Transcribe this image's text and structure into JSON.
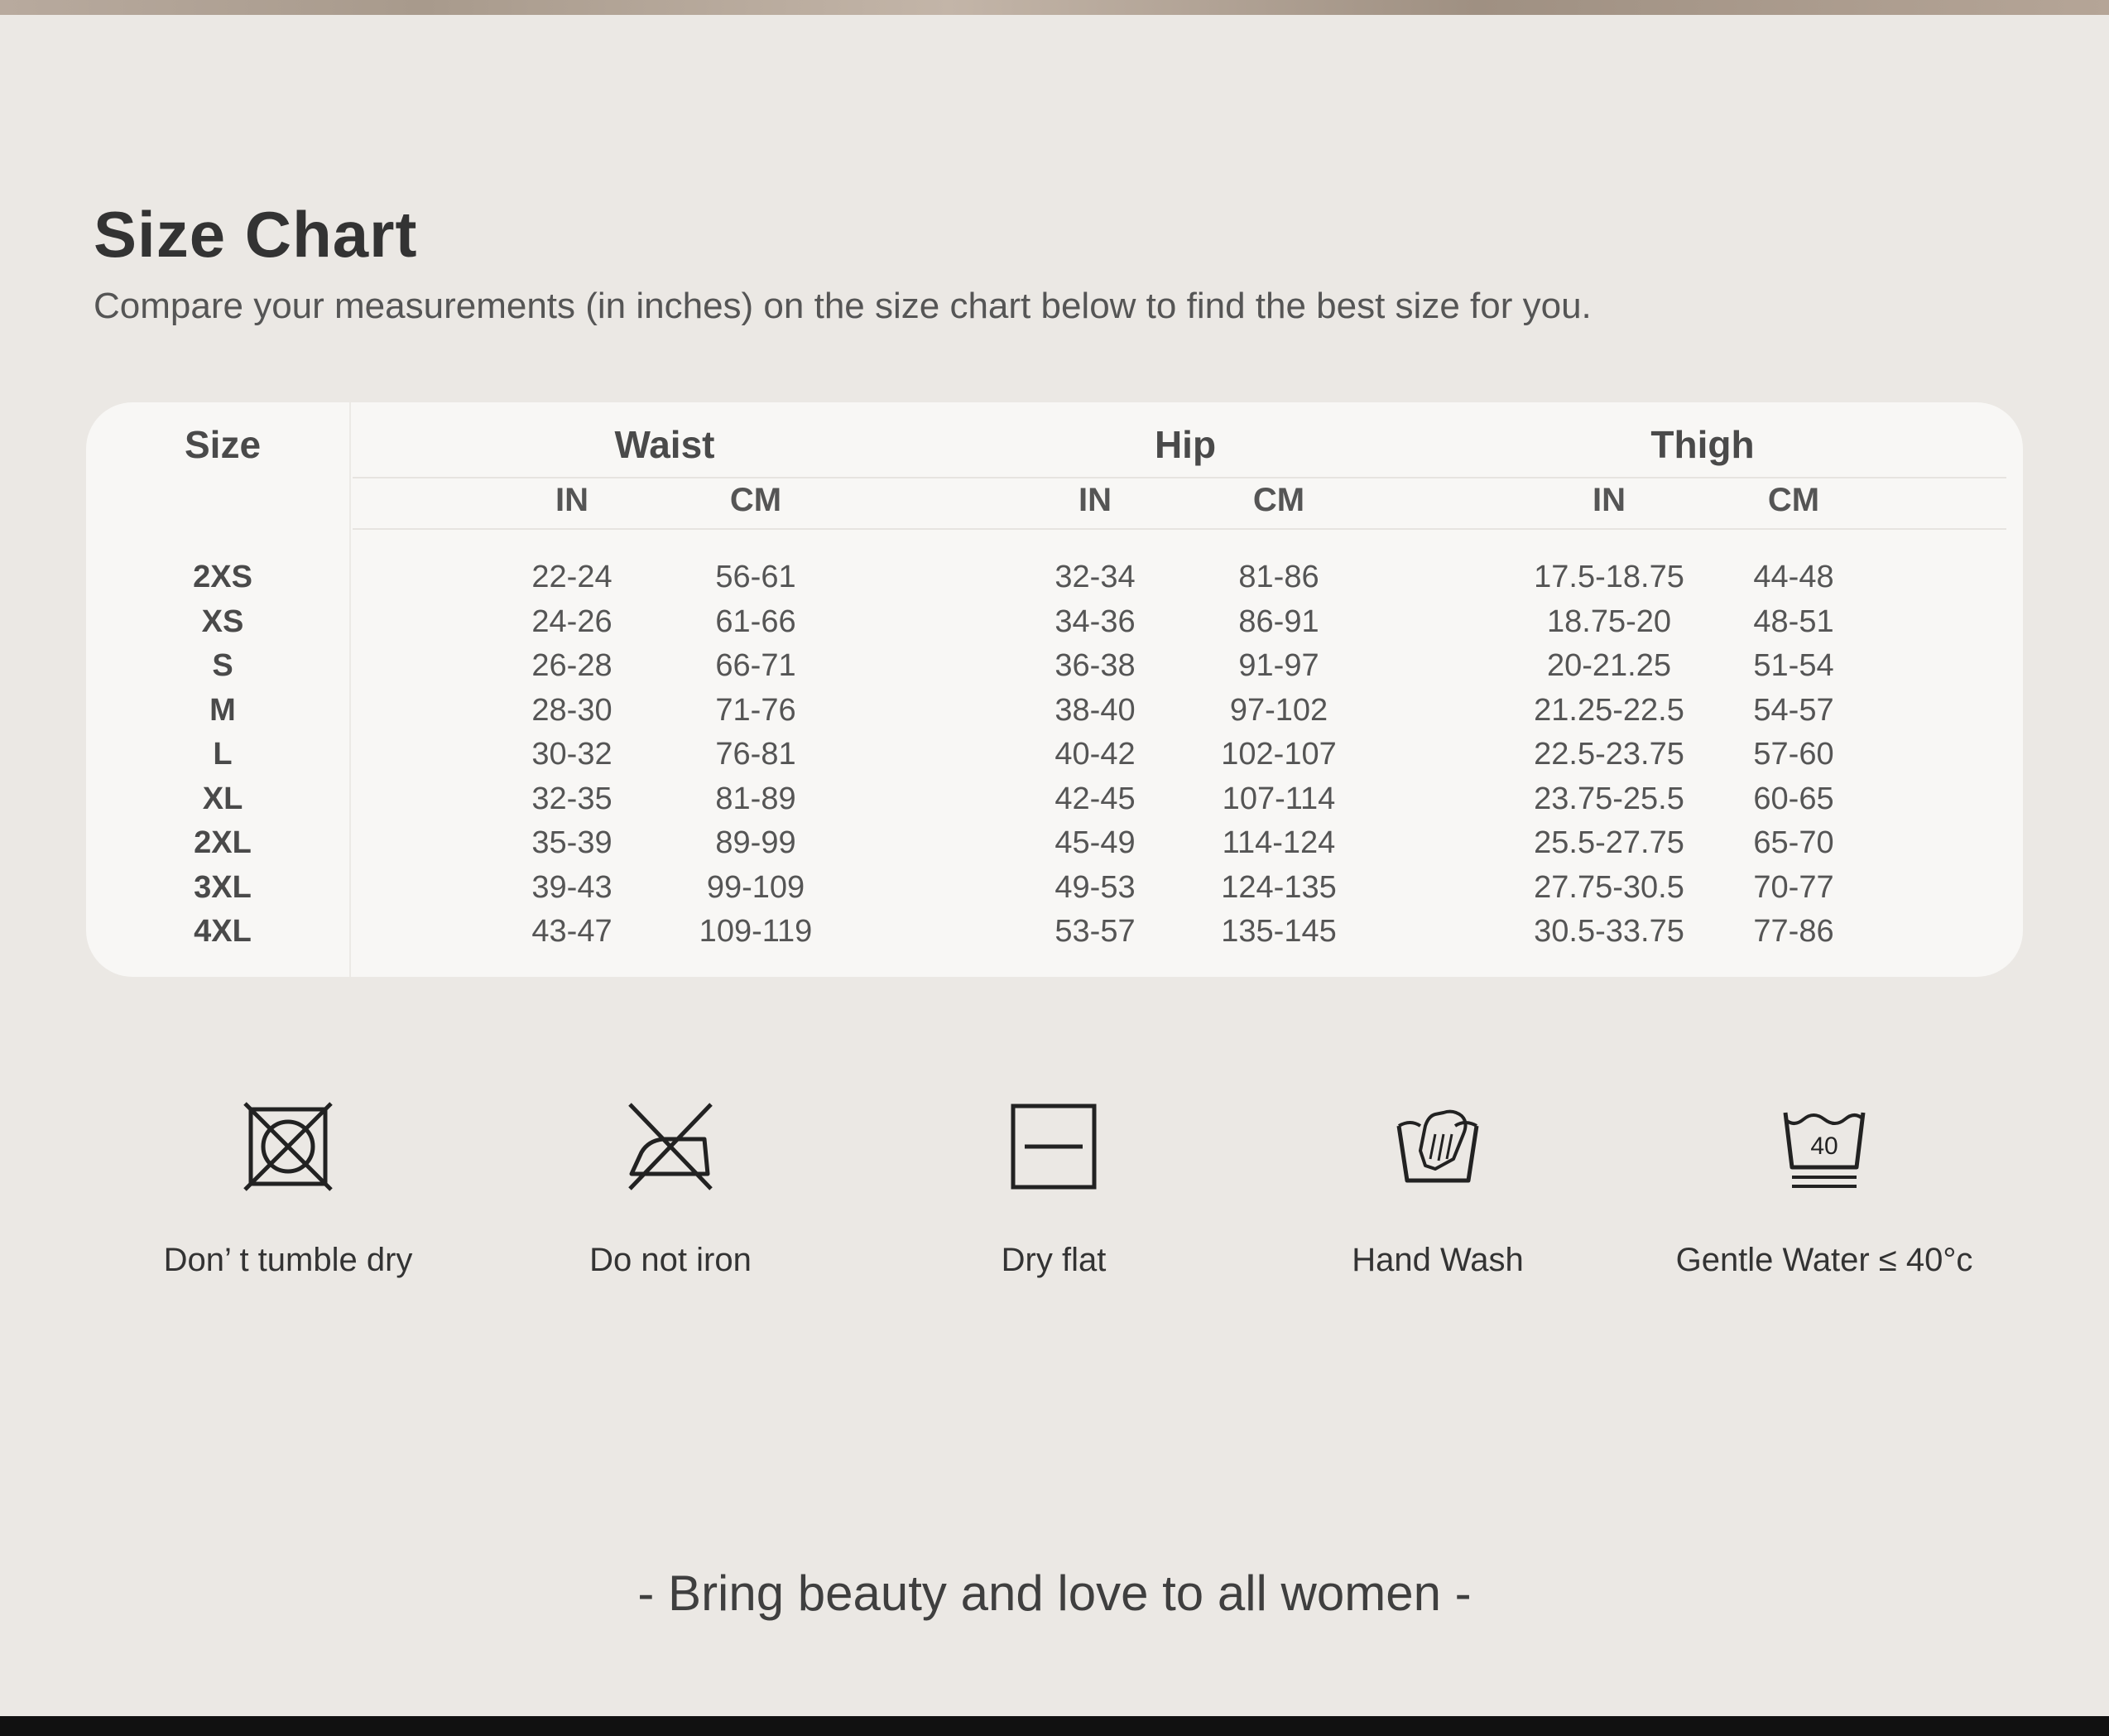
{
  "header": {
    "title": "Size Chart",
    "subtitle": "Compare your measurements (in inches) on the size chart below to find the best size for you."
  },
  "table": {
    "size_header": "Size",
    "groups": [
      {
        "label": "Waist",
        "units": [
          "IN",
          "CM"
        ]
      },
      {
        "label": "Hip",
        "units": [
          "IN",
          "CM"
        ]
      },
      {
        "label": "Thigh",
        "units": [
          "IN",
          "CM"
        ]
      }
    ],
    "rows": [
      {
        "size": "2XS",
        "values": [
          "22-24",
          "56-61",
          "32-34",
          "81-86",
          "17.5-18.75",
          "44-48"
        ]
      },
      {
        "size": "XS",
        "values": [
          "24-26",
          "61-66",
          "34-36",
          "86-91",
          "18.75-20",
          "48-51"
        ]
      },
      {
        "size": "S",
        "values": [
          "26-28",
          "66-71",
          "36-38",
          "91-97",
          "20-21.25",
          "51-54"
        ]
      },
      {
        "size": "M",
        "values": [
          "28-30",
          "71-76",
          "38-40",
          "97-102",
          "21.25-22.5",
          "54-57"
        ]
      },
      {
        "size": "L",
        "values": [
          "30-32",
          "76-81",
          "40-42",
          "102-107",
          "22.5-23.75",
          "57-60"
        ]
      },
      {
        "size": "XL",
        "values": [
          "32-35",
          "81-89",
          "42-45",
          "107-114",
          "23.75-25.5",
          "60-65"
        ]
      },
      {
        "size": "2XL",
        "values": [
          "35-39",
          "89-99",
          "45-49",
          "114-124",
          "25.5-27.75",
          "65-70"
        ]
      },
      {
        "size": "3XL",
        "values": [
          "39-43",
          "99-109",
          "49-53",
          "124-135",
          "27.75-30.5",
          "70-77"
        ]
      },
      {
        "size": "4XL",
        "values": [
          "43-47",
          "109-119",
          "53-57",
          "135-145",
          "30.5-33.75",
          "77-86"
        ]
      }
    ]
  },
  "care": [
    {
      "icon": "no-tumble-dry-icon",
      "label": "Don’ t tumble dry"
    },
    {
      "icon": "do-not-iron-icon",
      "label": "Do not iron"
    },
    {
      "icon": "dry-flat-icon",
      "label": "Dry flat"
    },
    {
      "icon": "hand-wash-icon",
      "label": "Hand Wash"
    },
    {
      "icon": "wash-40-icon",
      "label": "Gentle Water ≤ 40°c",
      "temp": "40"
    }
  ],
  "tagline": "- Bring beauty and love to all women -"
}
